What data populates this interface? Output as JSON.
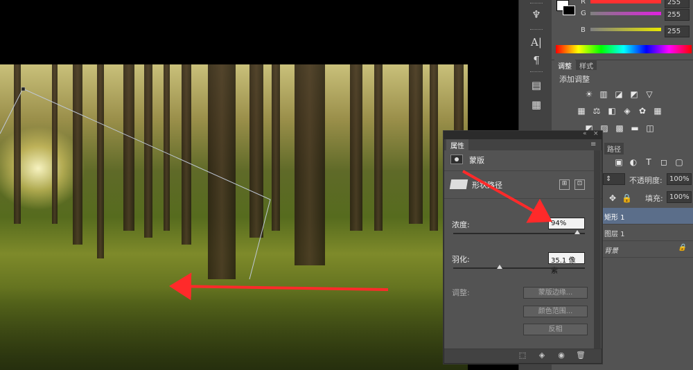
{
  "color_panel": {
    "r_label": "R",
    "g_label": "G",
    "b_label": "B",
    "r_value": "255",
    "g_value": "255",
    "b_value": "255",
    "g_bar_color": "#e020e0",
    "b_bar_color": "#e8e800"
  },
  "adjustments_panel": {
    "tabs": [
      "调整",
      "样式"
    ],
    "title": "添加调整"
  },
  "layers_panel": {
    "tab_label": "路径",
    "opacity_label": "不透明度:",
    "opacity_value": "100%",
    "fill_label": "填充:",
    "fill_value": "100%",
    "layers": [
      {
        "name": "矩形 1",
        "selected": true
      },
      {
        "name": "图层 1",
        "selected": false
      },
      {
        "name": "背景",
        "selected": false
      }
    ]
  },
  "properties_panel": {
    "tab_label": "属性",
    "mask_label": "蒙版",
    "shape_path_label": "形状路径",
    "density_label": "浓度:",
    "density_value": "94%",
    "density_level": 0.94,
    "feather_label": "羽化:",
    "feather_value": "35.1 像素",
    "feather_level": 0.352,
    "adjust_label": "调整:",
    "buttons": {
      "mask_edge": "蒙版边缘...",
      "color_range": "颜色范围...",
      "invert": "反相"
    }
  },
  "annotations": {
    "arrow_color": "#ff2a2a"
  },
  "icons": {
    "tools": [
      "brush-settings-icon",
      "character-icon",
      "paragraph-icon",
      "notes-icon",
      "clipboard-icon"
    ],
    "adjustment_row1": [
      "brightness-icon",
      "levels-icon",
      "curves-icon",
      "exposure-icon",
      "gradient-triangle-icon"
    ],
    "adjustment_row2": [
      "vibrance-icon",
      "color-balance-icon",
      "black-white-icon",
      "photo-filter-icon",
      "channel-mixer-icon",
      "color-lookup-icon"
    ],
    "adjustment_row3": [
      "invert-icon",
      "posterize-icon",
      "threshold-icon",
      "gradient-map-icon"
    ],
    "footer": [
      "selection-icon",
      "apply-mask-icon",
      "eye-icon",
      "trash-icon"
    ]
  }
}
